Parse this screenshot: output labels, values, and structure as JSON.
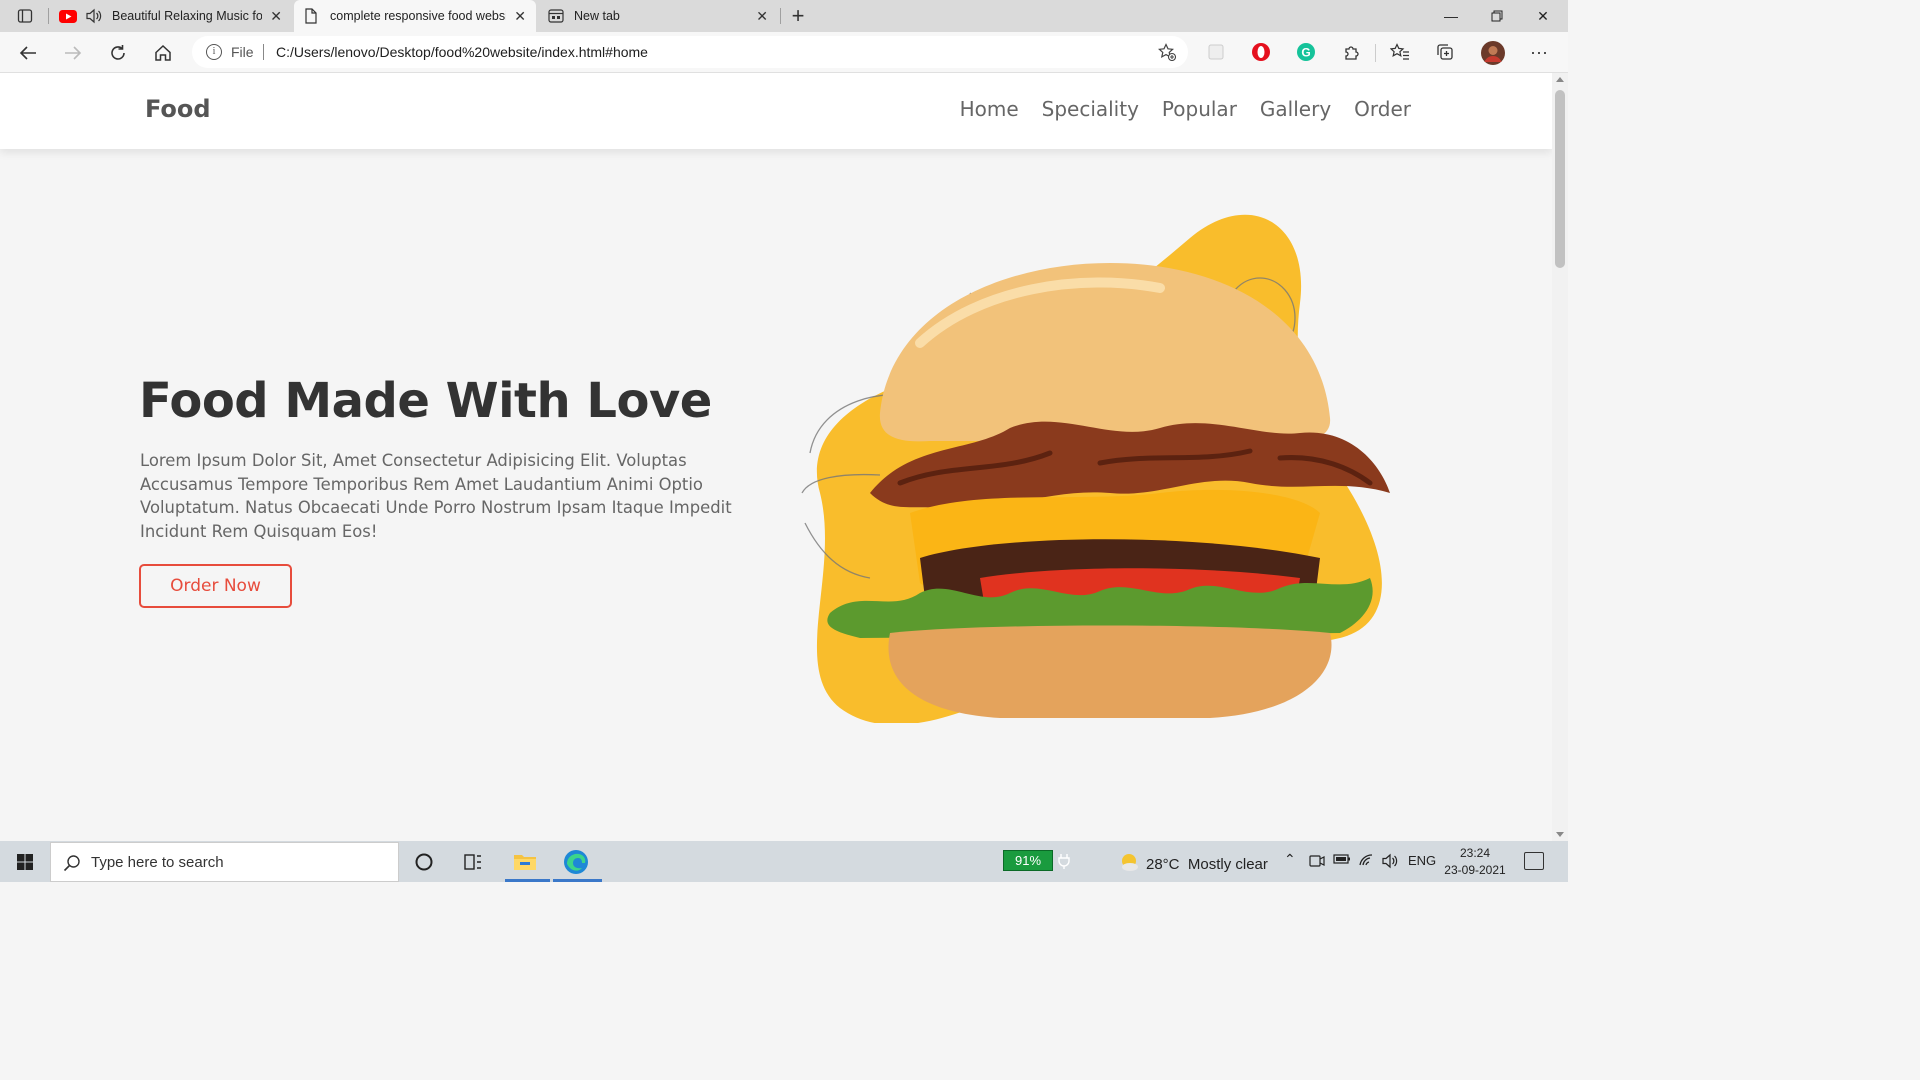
{
  "browser": {
    "tabs": [
      {
        "title": "Beautiful Relaxing Music for",
        "icon": "youtube-icon",
        "audio": true
      },
      {
        "title": "complete responsive food websi",
        "icon": "page-icon",
        "active": true
      },
      {
        "title": "New tab",
        "icon": "new-tab-icon"
      }
    ],
    "address": {
      "file_label": "File",
      "url": "C:/Users/lenovo/Desktop/food%20website/index.html#home"
    }
  },
  "site": {
    "logo": "Food",
    "nav": [
      "Home",
      "Speciality",
      "Popular",
      "Gallery",
      "Order"
    ],
    "hero": {
      "title": "Food Made With Love",
      "description": "Lorem Ipsum Dolor Sit, Amet Consectetur Adipisicing Elit. Voluptas Accusamus Tempore Temporibus Rem Amet Laudantium Animi Optio Voluptatum. Natus Obcaecati Unde Porro Nostrum Ipsam Itaque Impedit Incidunt Rem Quisquam Eos!",
      "button": "Order Now"
    },
    "colors": {
      "accent": "#e74c3c",
      "blob": "#f9bd2c"
    }
  },
  "taskbar": {
    "search_placeholder": "Type here to search",
    "battery": "91%",
    "weather": "28°C  Mostly clear",
    "language": "ENG",
    "time": "23:24",
    "date": "23-09-2021"
  }
}
